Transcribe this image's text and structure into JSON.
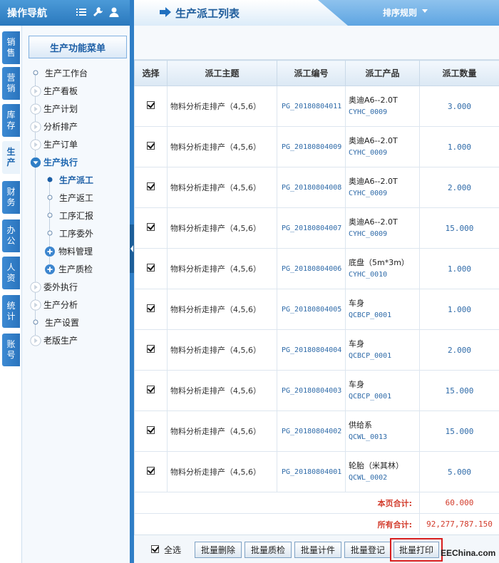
{
  "nav": {
    "title": "操作导航",
    "header_icons": [
      "list-icon",
      "wrench-icon",
      "user-icon"
    ],
    "vertical_tabs": [
      "销售",
      "营销",
      "库存",
      "生产",
      "财务",
      "办公",
      "人资",
      "统计",
      "账号"
    ],
    "active_tab": "生产",
    "menu_title": "生产功能菜单",
    "tree": [
      {
        "label": "生产工作台",
        "node": "leaf"
      },
      {
        "label": "生产看板",
        "node": "collapsed"
      },
      {
        "label": "生产计划",
        "node": "collapsed"
      },
      {
        "label": "分析排产",
        "node": "collapsed"
      },
      {
        "label": "生产订单",
        "node": "collapsed"
      },
      {
        "label": "生产执行",
        "node": "expanded"
      },
      {
        "label": "生产派工",
        "node": "current"
      },
      {
        "label": "生产返工",
        "node": "leaf"
      },
      {
        "label": "工序汇报",
        "node": "leaf"
      },
      {
        "label": "工序委外",
        "node": "leaf"
      },
      {
        "label": "物料管理",
        "node": "plus"
      },
      {
        "label": "生产质检",
        "node": "plus"
      },
      {
        "label": "委外执行",
        "node": "collapsed"
      },
      {
        "label": "生产分析",
        "node": "collapsed"
      },
      {
        "label": "生产设置",
        "node": "leaf"
      },
      {
        "label": "老版生产",
        "node": "collapsed"
      }
    ]
  },
  "main": {
    "title": "生产派工列表",
    "sort_label": "排序规则",
    "columns": [
      "选择",
      "派工主题",
      "派工编号",
      "派工产品",
      "派工数量"
    ],
    "rows": [
      {
        "subject": "物料分析走排产（4,5,6）",
        "code": "PG_20180804011",
        "product": "奥迪A6--2.0T",
        "product_code": "CYHC_0009",
        "qty": "3.000"
      },
      {
        "subject": "物料分析走排产（4,5,6）",
        "code": "PG_20180804009",
        "product": "奥迪A6--2.0T",
        "product_code": "CYHC_0009",
        "qty": "1.000"
      },
      {
        "subject": "物料分析走排产（4,5,6）",
        "code": "PG_20180804008",
        "product": "奥迪A6--2.0T",
        "product_code": "CYHC_0009",
        "qty": "2.000"
      },
      {
        "subject": "物料分析走排产（4,5,6）",
        "code": "PG_20180804007",
        "product": "奥迪A6--2.0T",
        "product_code": "CYHC_0009",
        "qty": "15.000"
      },
      {
        "subject": "物料分析走排产（4,5,6）",
        "code": "PG_20180804006",
        "product": "底盘（5m*3m）",
        "product_code": "CYHC_0010",
        "qty": "1.000"
      },
      {
        "subject": "物料分析走排产（4,5,6）",
        "code": "PG_20180804005",
        "product": "车身",
        "product_code": "QCBCP_0001",
        "qty": "1.000"
      },
      {
        "subject": "物料分析走排产（4,5,6）",
        "code": "PG_20180804004",
        "product": "车身",
        "product_code": "QCBCP_0001",
        "qty": "2.000"
      },
      {
        "subject": "物料分析走排产（4,5,6）",
        "code": "PG_20180804003",
        "product": "车身",
        "product_code": "QCBCP_0001",
        "qty": "15.000"
      },
      {
        "subject": "物料分析走排产（4,5,6）",
        "code": "PG_20180804002",
        "product": "供给系",
        "product_code": "QCWL_0013",
        "qty": "15.000"
      },
      {
        "subject": "物料分析走排产（4,5,6）",
        "code": "PG_20180804001",
        "product": "轮胎（米其林）",
        "product_code": "QCWL_0002",
        "qty": "5.000"
      }
    ],
    "page_total_label": "本页合计:",
    "page_total": "60.000",
    "grand_total_label": "所有合计:",
    "grand_total": "92,277,787.150"
  },
  "footer": {
    "select_all": "全选",
    "buttons": [
      "批量删除",
      "批量质检",
      "批量计件",
      "批量登记",
      "批量打印"
    ],
    "watermark": "EEChina.com"
  },
  "colors": {
    "nav_blue": "#2a78bd",
    "highlight_red": "#d81e1e",
    "total_red": "#d23a2a",
    "code_blue": "#2e6aa8"
  }
}
